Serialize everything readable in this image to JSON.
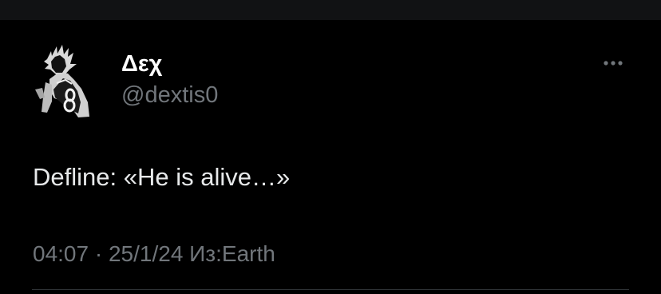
{
  "tweet": {
    "author": {
      "display_name": "Δεχ",
      "handle": "@dextis0",
      "avatar_icon": "anime-character-avatar-icon"
    },
    "text": "Defline: «He is alive…»",
    "meta": {
      "time": "04:07",
      "separator": " · ",
      "date": "25/1/24",
      "source": "Из:Earth"
    },
    "more_icon": "more-horizontal-icon"
  },
  "colors": {
    "background": "#000000",
    "top_bar": "#111214",
    "primary_text": "#e7e9ea",
    "secondary_text": "#71767b",
    "divider": "#2f3336"
  }
}
